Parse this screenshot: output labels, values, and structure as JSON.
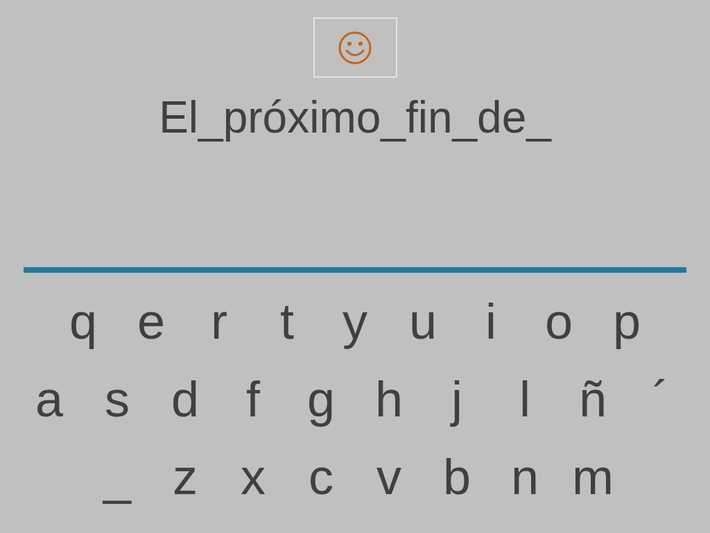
{
  "sentence": "El_próximo_fin_de_",
  "keyboard": {
    "rows": [
      [
        "q",
        "e",
        "r",
        "t",
        "y",
        "u",
        "i",
        "o",
        "p"
      ],
      [
        "a",
        "s",
        "d",
        "f",
        "g",
        "h",
        "j",
        "l",
        "ñ",
        "´"
      ],
      [
        "_",
        "z",
        "x",
        "c",
        "v",
        "b",
        "n",
        "m"
      ]
    ]
  }
}
